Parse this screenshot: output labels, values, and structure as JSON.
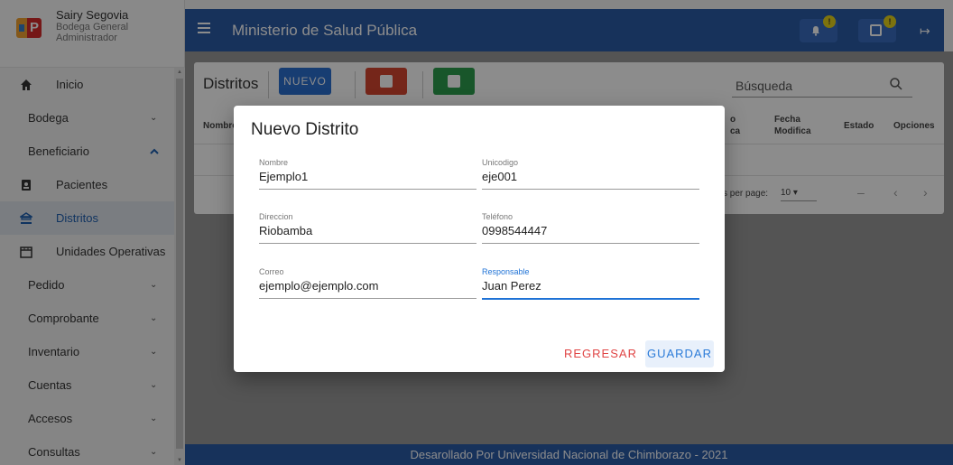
{
  "profile": {
    "name": "Sairy Segovia",
    "warehouse": "Bodega General",
    "role": "Administrador",
    "logo_letter": "P"
  },
  "sidebar": {
    "items": [
      {
        "label": "Inicio",
        "icon": "home-icon"
      },
      {
        "label": "Bodega",
        "expand": "chevron-down"
      },
      {
        "label": "Beneficiario",
        "expand": "chevron-up"
      },
      {
        "label": "Pacientes",
        "icon": "badge-icon"
      },
      {
        "label": "Distritos",
        "icon": "bank-icon",
        "active": true
      },
      {
        "label": "Unidades Operativas",
        "icon": "store-icon"
      },
      {
        "label": "Pedido",
        "expand": "chevron-down"
      },
      {
        "label": "Comprobante",
        "expand": "chevron-down"
      },
      {
        "label": "Inventario",
        "expand": "chevron-down"
      },
      {
        "label": "Cuentas",
        "expand": "chevron-down"
      },
      {
        "label": "Accesos",
        "expand": "chevron-down"
      },
      {
        "label": "Consultas",
        "expand": "chevron-down"
      }
    ]
  },
  "header": {
    "title": "Ministerio de Salud Pública",
    "notif_badge": "!",
    "calendar_badge": "!"
  },
  "page": {
    "title": "Distritos",
    "new_button": "NUEVO",
    "search_placeholder": "Búsqueda",
    "columns": [
      "Nombre",
      "o",
      "ca",
      "Fecha",
      "Modifica",
      "Estado",
      "Opciones"
    ],
    "rows_per_page_label": "s per page:",
    "rows_per_page_value": "10",
    "range_text": "–"
  },
  "dialog": {
    "title": "Nuevo Distrito",
    "fields": {
      "nombre": {
        "label": "Nombre",
        "value": "Ejemplo1"
      },
      "unicodigo": {
        "label": "Unicodigo",
        "value": "eje001"
      },
      "direccion": {
        "label": "Direccion",
        "value": "Riobamba"
      },
      "telefono": {
        "label": "Teléfono",
        "value": "0998544447"
      },
      "correo": {
        "label": "Correo",
        "value": "ejemplo@ejemplo.com"
      },
      "responsable": {
        "label": "Responsable",
        "value": "Juan Perez"
      }
    },
    "back_button": "REGRESAR",
    "save_button": "GUARDAR"
  },
  "footer": {
    "text": "Desarollado Por Universidad Nacional de Chimborazo - 2021"
  },
  "colors": {
    "primary": "#2b5ba7",
    "new_button": "#2b6fd0",
    "print_button": "#d64531",
    "export_button": "#2d9d4e",
    "badge": "#e4d21b"
  }
}
